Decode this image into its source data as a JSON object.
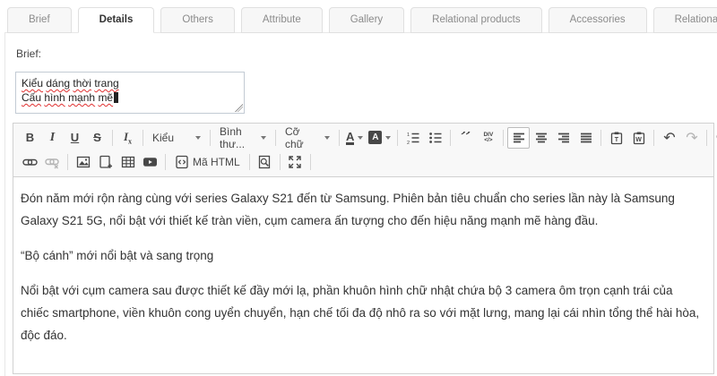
{
  "tabs": [
    {
      "label": "Brief",
      "active": false
    },
    {
      "label": "Details",
      "active": true
    },
    {
      "label": "Others",
      "active": false
    },
    {
      "label": "Attribute",
      "active": false
    },
    {
      "label": "Gallery",
      "active": false
    },
    {
      "label": "Relational products",
      "active": false
    },
    {
      "label": "Accessories",
      "active": false
    },
    {
      "label": "Relational articles",
      "active": false
    }
  ],
  "brief": {
    "label": "Brief:",
    "lines": [
      "Kiểu dáng thời trang",
      "Cấu hình mạnh mẽ"
    ]
  },
  "editor": {
    "toolbar": {
      "bold_label": "B",
      "italic_label": "I",
      "underline_label": "U",
      "strike_label": "S",
      "remove_format_base": "I",
      "remove_format_sub": "x",
      "styles_label": "Kiểu",
      "format_label": "Bình thư...",
      "size_label": "Cỡ chữ",
      "text_color_glyph": "A",
      "bg_color_glyph": "A",
      "blockquote_glyph": "”",
      "div_line1": "DIV",
      "div_line2": "</>",
      "undo_glyph": "↶",
      "redo_glyph": "↷",
      "source_label": "Mã HTML"
    },
    "content": {
      "paragraphs": [
        "Đón năm mới rộn ràng cùng với series Galaxy S21 đến từ Samsung. Phiên bản tiêu chuẩn cho series lần này là Samsung Galaxy S21 5G, nổi bật với thiết kế tràn viền, cụm camera ấn tượng cho đến hiệu năng mạnh mẽ hàng đầu.",
        "“Bộ cánh” mới nổi bật và sang trọng",
        "Nổi bật với cụm camera sau được thiết kế đầy mới lạ, phần khuôn hình chữ nhật chứa bộ 3 camera ôm trọn cạnh trái của chiếc smartphone, viền khuôn cong uyển chuyển, hạn chế tối đa độ nhô ra so với mặt lưng, mang lại cái nhìn tổng thể hài hòa, độc đáo."
      ]
    }
  },
  "colors": {
    "editor_border": "#d1d1d1",
    "toolbar_bg": "#f8f8f8",
    "icon": "#474747",
    "spellcheck_underline": "#e03131",
    "active_tab_text": "#333333",
    "inactive_tab_text": "#8b8b8b"
  }
}
